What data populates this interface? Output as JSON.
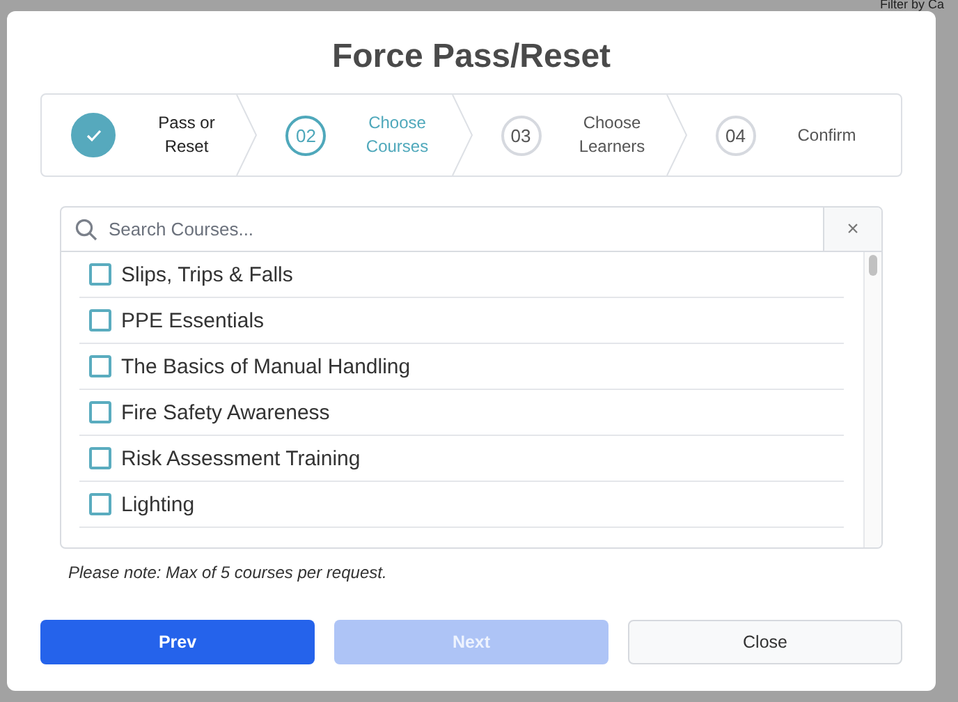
{
  "background": {
    "filter_label": "Filter by Ca"
  },
  "dialog": {
    "title": "Force Pass/Reset"
  },
  "steps": [
    {
      "label": "Pass or Reset",
      "completed": true,
      "selected": false
    },
    {
      "number": "02",
      "label": "Choose Courses",
      "completed": false,
      "selected": true
    },
    {
      "number": "03",
      "label": "Choose Learners",
      "completed": false,
      "selected": false
    },
    {
      "number": "04",
      "label": "Confirm",
      "completed": false,
      "selected": false
    }
  ],
  "search": {
    "placeholder": "Search Courses...",
    "clear": "×"
  },
  "courses": [
    {
      "name": "Slips, Trips & Falls",
      "checked": false
    },
    {
      "name": "PPE Essentials",
      "checked": false
    },
    {
      "name": "The Basics of Manual Handling",
      "checked": false
    },
    {
      "name": "Fire Safety Awareness",
      "checked": false
    },
    {
      "name": "Risk Assessment Training",
      "checked": false
    },
    {
      "name": "Lighting",
      "checked": false
    }
  ],
  "note": "Please note: Max of 5 courses per request.",
  "buttons": [
    {
      "label": "Prev",
      "kind": "primary",
      "disabled": false
    },
    {
      "label": "Next",
      "kind": "primary",
      "disabled": true
    },
    {
      "label": "Close",
      "kind": "secondary",
      "disabled": false
    }
  ]
}
